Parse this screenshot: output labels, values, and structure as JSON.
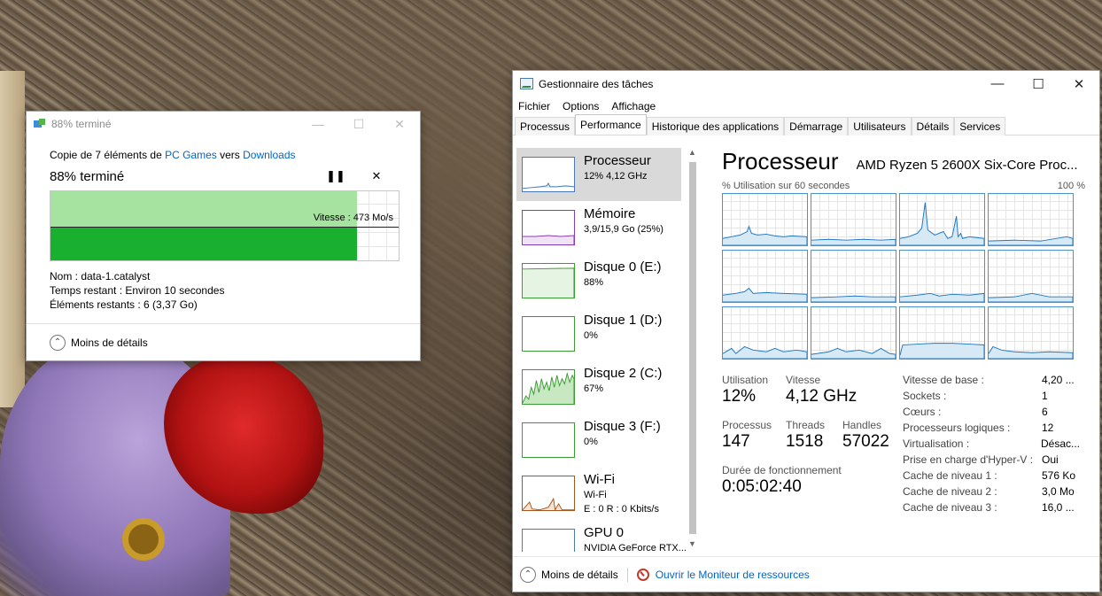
{
  "copy_dialog": {
    "title": "88% terminé",
    "copy_prefix": "Copie de 7 éléments de ",
    "source": "PC Games",
    "copy_middle": " vers ",
    "destination": "Downloads",
    "status": "88% terminé",
    "progress_fraction": 0.88,
    "speed": "Vitesse : 473 Mo/s",
    "name_row": "Nom :  data-1.catalyst",
    "time_row": "Temps restant :  Environ 10 secondes",
    "items_row": "Éléments restants :  6 (3,37 Go)",
    "less_details": "Moins de détails",
    "pause_icon": "pause-icon",
    "close_icon": "close-icon"
  },
  "task_manager": {
    "title": "Gestionnaire des tâches",
    "menu": [
      "Fichier",
      "Options",
      "Affichage"
    ],
    "tabs": [
      "Processus",
      "Performance",
      "Historique des applications",
      "Démarrage",
      "Utilisateurs",
      "Détails",
      "Services"
    ],
    "active_tab": "Performance",
    "sidebar": [
      {
        "name": "Processeur",
        "sub": "12%  4,12 GHz",
        "color": "#4a7ab5"
      },
      {
        "name": "Mémoire",
        "sub": "3,9/15,9 Go (25%)",
        "color": "#8b3cb0"
      },
      {
        "name": "Disque 0 (E:)",
        "sub": "88%",
        "color": "#3d9b35"
      },
      {
        "name": "Disque 1 (D:)",
        "sub": "0%",
        "color": "#3d9b35"
      },
      {
        "name": "Disque 2 (C:)",
        "sub": "67%",
        "color": "#3d9b35"
      },
      {
        "name": "Disque 3 (F:)",
        "sub": "0%",
        "color": "#3d9b35"
      },
      {
        "name": "Wi-Fi",
        "sub": "Wi-Fi",
        "sub2": "E : 0 R : 0 Kbits/s",
        "color": "#a3571e"
      },
      {
        "name": "GPU 0",
        "sub": "NVIDIA GeForce RTX...",
        "color": "#4a7ab5"
      }
    ],
    "main": {
      "title": "Processeur",
      "model": "AMD Ryzen 5 2600X Six-Core Proc...",
      "util_caption": "% Utilisation sur 60 secondes",
      "util_max": "100 %",
      "stats": {
        "utilisation_label": "Utilisation",
        "utilisation": "12%",
        "vitesse_label": "Vitesse",
        "vitesse": "4,12 GHz",
        "processus_label": "Processus",
        "processus": "147",
        "threads_label": "Threads",
        "threads": "1518",
        "handles_label": "Handles",
        "handles": "57022",
        "uptime_label": "Durée de fonctionnement",
        "uptime": "0:05:02:40"
      },
      "properties": [
        {
          "k": "Vitesse de base :",
          "v": "4,20 ..."
        },
        {
          "k": "Sockets :",
          "v": "1"
        },
        {
          "k": "Cœurs :",
          "v": "6"
        },
        {
          "k": "Processeurs logiques :",
          "v": "12"
        },
        {
          "k": "Virtualisation :",
          "v": "Désac..."
        },
        {
          "k": "Prise en charge d'Hyper-V :",
          "v": "Oui"
        },
        {
          "k": "Cache de niveau 1 :",
          "v": "576 Ko"
        },
        {
          "k": "Cache de niveau 2 :",
          "v": "3,0 Mo"
        },
        {
          "k": "Cache de niveau 3 :",
          "v": "16,0 ..."
        }
      ]
    },
    "footer": {
      "less_details": "Moins de détails",
      "resource_monitor": "Ouvrir le Moniteur de ressources"
    }
  }
}
